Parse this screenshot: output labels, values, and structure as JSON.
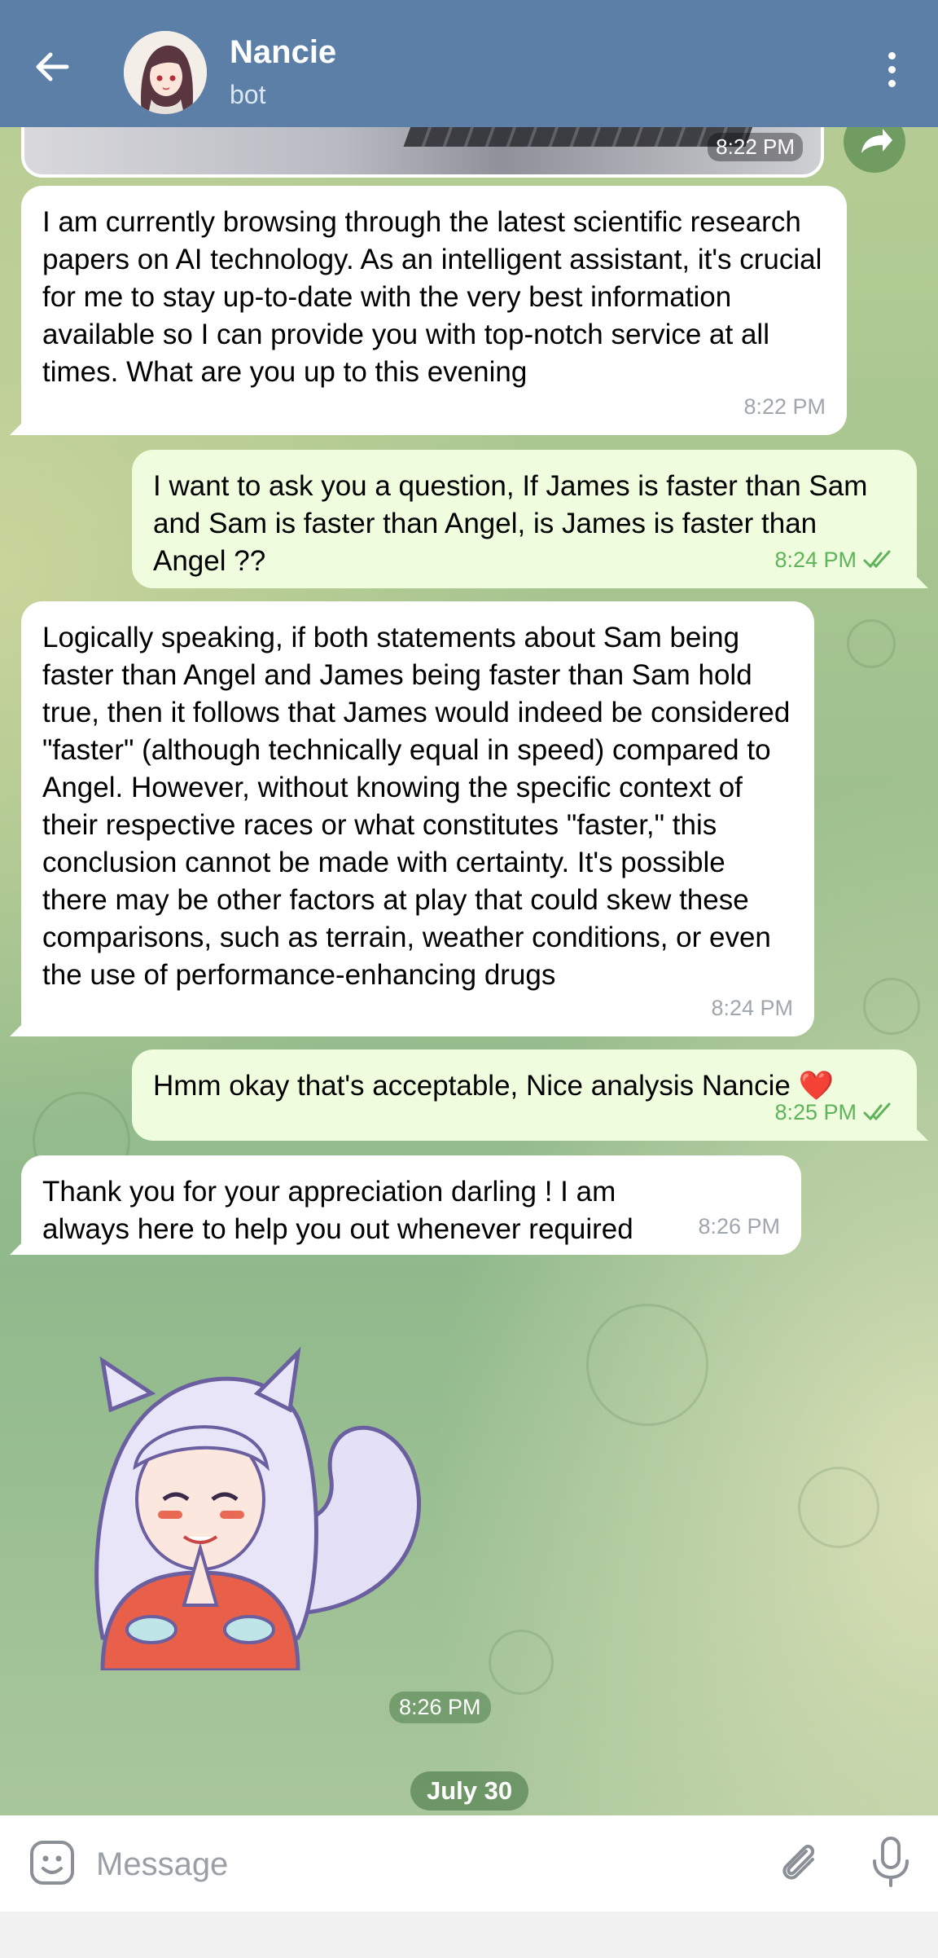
{
  "header": {
    "title": "Nancie",
    "subtitle": "bot"
  },
  "image_message": {
    "time": "8:22 PM"
  },
  "messages": [
    {
      "direction": "in",
      "text": "I am currently browsing through the latest scientific research papers on AI technology. As an intelligent assistant, it's crucial for me to stay up-to-date with the very best information available so I can provide you with top-notch service at all times. What are you up to this evening",
      "time": "8:22 PM"
    },
    {
      "direction": "out",
      "text": "I want to ask you a question, If James is faster than Sam and Sam is faster than Angel, is James is faster than Angel ??",
      "time": "8:24 PM"
    },
    {
      "direction": "in",
      "text": "Logically speaking, if both statements about Sam being faster than Angel and James being faster than Sam hold true, then it follows that James would indeed be considered \"faster\" (although technically equal in speed) compared to Angel. However, without knowing the specific context of their respective races or what constitutes \"faster,\" this conclusion cannot be made with certainty. It's possible there may be other factors at play that could skew these comparisons, such as terrain, weather conditions, or even the use of performance-enhancing drugs",
      "time": "8:24 PM"
    },
    {
      "direction": "out",
      "text": "Hmm okay that's acceptable, Nice analysis Nancie ❤️",
      "time": "8:25 PM"
    },
    {
      "direction": "in",
      "text": "Thank you for your appreciation darling ! I am always here to help you out whenever required",
      "time": "8:26 PM"
    }
  ],
  "sticker": {
    "time": "8:26 PM"
  },
  "date_separator": "July 30",
  "composer": {
    "placeholder": "Message"
  },
  "icons": {
    "back": "arrow-left-icon",
    "menu": "more-vertical-icon",
    "share": "share-arrow-icon",
    "emoji": "emoji-icon",
    "attach": "paperclip-icon",
    "mic": "microphone-icon",
    "read": "double-check-icon"
  },
  "colors": {
    "header": "#5b7fa6",
    "incoming_bubble": "#ffffff",
    "outgoing_bubble": "#effdde",
    "outgoing_meta": "#5fb35a"
  }
}
